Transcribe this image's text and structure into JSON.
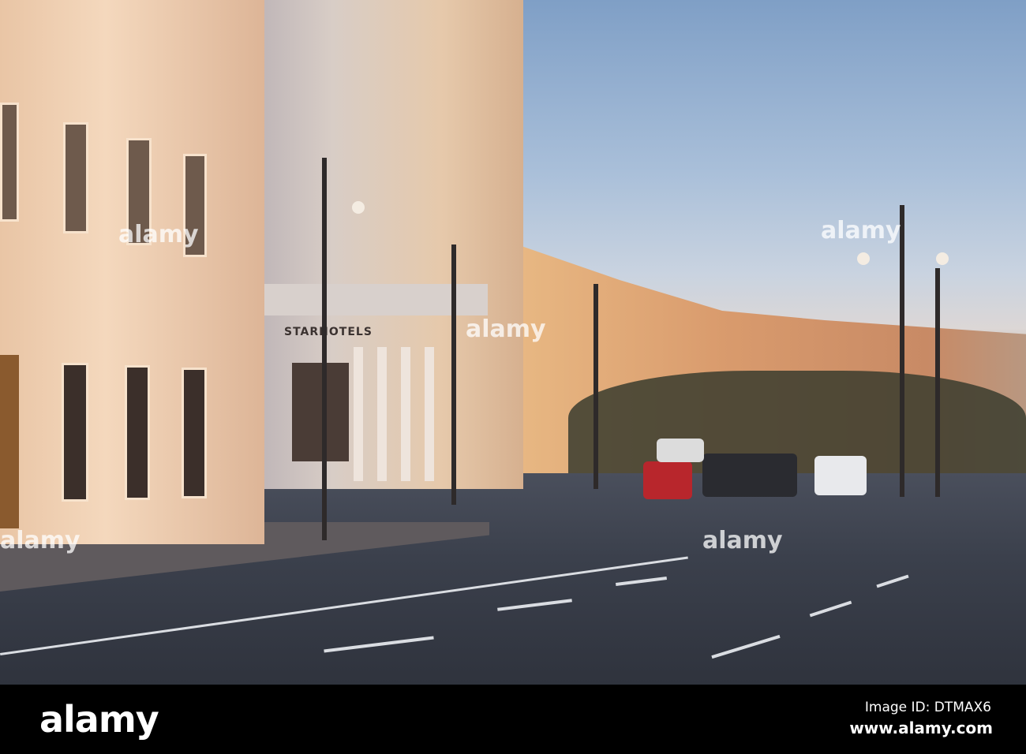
{
  "photo": {
    "building_sign": "STARHOTELS",
    "watermark_text": "alamy"
  },
  "footer": {
    "logo": "alamy",
    "image_id": "Image ID: DTMAX6",
    "url": "www.alamy.com"
  }
}
